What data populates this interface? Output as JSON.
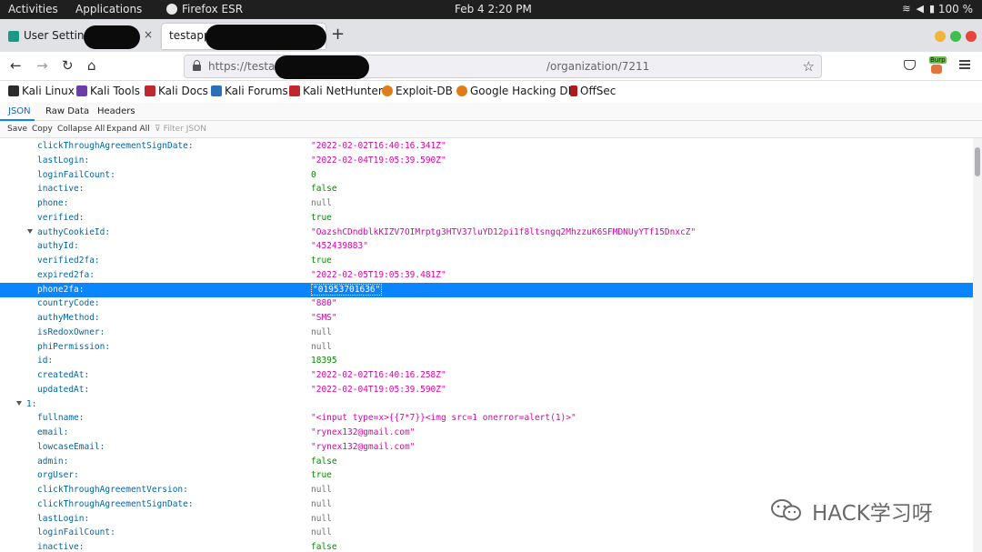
{
  "system_bar": {
    "activities": "Activities",
    "applications": "Applications",
    "app_name": "Firefox ESR",
    "clock": "Feb 4  2:20 PM",
    "battery": "100 %"
  },
  "tabs": [
    {
      "label": "User Settings",
      "close": "×"
    },
    {
      "label": "testapp",
      "close": "×"
    }
  ],
  "new_tab": "+",
  "window_colors": {
    "min": "#f0b43a",
    "max": "#3fbf4c",
    "close": "#e8453c"
  },
  "nav": {
    "back": "←",
    "forward": "→",
    "reload": "↻",
    "home": "⌂",
    "url_prefix": "https://testap",
    "url_suffix": "/organization/7211",
    "star": "☆",
    "burp_label": "Burp"
  },
  "bookmarks": [
    {
      "label": "Kali Linux",
      "color": "#2b2b2b"
    },
    {
      "label": "Kali Tools",
      "color": "#6a3ea8"
    },
    {
      "label": "Kali Docs",
      "color": "#c0282d"
    },
    {
      "label": "Kali Forums",
      "color": "#2a6fb8"
    },
    {
      "label": "Kali NetHunter",
      "color": "#c0282d"
    },
    {
      "label": "Exploit-DB",
      "color": "#e07b1a"
    },
    {
      "label": "Google Hacking DB",
      "color": "#e07b1a"
    },
    {
      "label": "OffSec",
      "color": "#b0181c"
    }
  ],
  "viewer_tabs": [
    "JSON",
    "Raw Data",
    "Headers"
  ],
  "viewer_tools": [
    "Save",
    "Copy",
    "Collapse All",
    "Expand All"
  ],
  "filter_placeholder": "Filter JSON",
  "rows": [
    {
      "key": "clickThroughAgreementSignDate:",
      "value": "\"2022-02-02T16:40:16.341Z\"",
      "type": "str",
      "indent": 41
    },
    {
      "key": "lastLogin:",
      "value": "\"2022-02-04T19:05:39.590Z\"",
      "type": "str",
      "indent": 41
    },
    {
      "key": "loginFailCount:",
      "value": "0",
      "type": "num",
      "indent": 41
    },
    {
      "key": "inactive:",
      "value": "false",
      "type": "bool",
      "indent": 41
    },
    {
      "key": "phone:",
      "value": "null",
      "type": "nul",
      "indent": 41
    },
    {
      "key": "verified:",
      "value": "true",
      "type": "bool",
      "indent": 41
    },
    {
      "key": "authyCookieId:",
      "value": "\"OazshCDndblkKIZV7OIMrptg3HTV37luYD12pi1f8ltsngq2MhzzuK6SFMDNUyYTf15DnxcZ\"",
      "type": "str",
      "indent": 41,
      "twisty": true
    },
    {
      "key": "authyId:",
      "value": "\"452439883\"",
      "type": "str",
      "indent": 41
    },
    {
      "key": "verified2fa:",
      "value": "true",
      "type": "bool",
      "indent": 41
    },
    {
      "key": "expired2fa:",
      "value": "\"2022-02-05T19:05:39.481Z\"",
      "type": "str",
      "indent": 41
    },
    {
      "key": "phone2fa:",
      "value": "\"01953701636\"",
      "type": "str",
      "indent": 41,
      "selected": true
    },
    {
      "key": "countryCode:",
      "value": "\"880\"",
      "type": "str",
      "indent": 41
    },
    {
      "key": "authyMethod:",
      "value": "\"SMS\"",
      "type": "str",
      "indent": 41
    },
    {
      "key": "isRedoxOwner:",
      "value": "null",
      "type": "nul",
      "indent": 41
    },
    {
      "key": "phiPermission:",
      "value": "null",
      "type": "nul",
      "indent": 41
    },
    {
      "key": "id:",
      "value": "18395",
      "type": "num",
      "indent": 41
    },
    {
      "key": "createdAt:",
      "value": "\"2022-02-02T16:40:16.258Z\"",
      "type": "str",
      "indent": 41
    },
    {
      "key": "updatedAt:",
      "value": "\"2022-02-04T19:05:39.590Z\"",
      "type": "str",
      "indent": 41
    },
    {
      "key": "1:",
      "value": "",
      "type": "str",
      "indent": 29,
      "twisty": true
    },
    {
      "key": "fullname:",
      "value": "\"<input type=x>{{7*7}}<img src=1 onerror=alert(1)>\"",
      "type": "str",
      "indent": 41
    },
    {
      "key": "email:",
      "value": "\"rynex132@gmail.com\"",
      "type": "str",
      "indent": 41
    },
    {
      "key": "lowcaseEmail:",
      "value": "\"rynex132@gmail.com\"",
      "type": "str",
      "indent": 41
    },
    {
      "key": "admin:",
      "value": "false",
      "type": "bool",
      "indent": 41
    },
    {
      "key": "orgUser:",
      "value": "true",
      "type": "bool",
      "indent": 41
    },
    {
      "key": "clickThroughAgreementVersion:",
      "value": "null",
      "type": "nul",
      "indent": 41
    },
    {
      "key": "clickThroughAgreementSignDate:",
      "value": "null",
      "type": "nul",
      "indent": 41
    },
    {
      "key": "lastLogin:",
      "value": "null",
      "type": "nul",
      "indent": 41
    },
    {
      "key": "loginFailCount:",
      "value": "null",
      "type": "nul",
      "indent": 41
    },
    {
      "key": "inactive:",
      "value": "false",
      "type": "bool",
      "indent": 41
    }
  ],
  "watermark": "HACK学习呀"
}
